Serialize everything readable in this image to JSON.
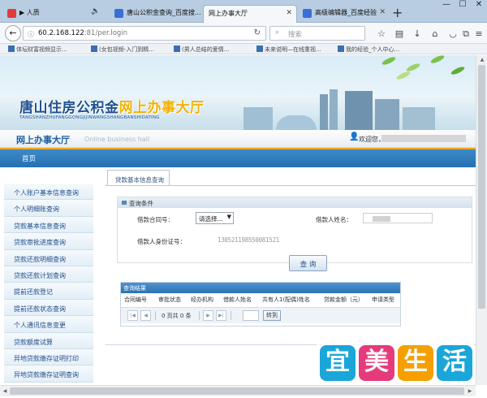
{
  "browser": {
    "tabs": [
      {
        "label": "▶ 人质",
        "active": false
      },
      {
        "label": "唐山公积金查询_百度搜...",
        "active": false
      },
      {
        "label": "网上办事大厅",
        "active": true
      },
      {
        "label": "高级编辑器_百度经验",
        "active": false
      }
    ],
    "new_tab": "+",
    "window_controls": {
      "minimize": "—",
      "maximize": "☐",
      "close": "✕"
    },
    "address": {
      "domain": "60.2.168.122",
      "rest": ":81/per.login"
    },
    "search_placeholder": "搜索",
    "bookmarks": [
      "体坛财富视频显示...",
      "(女包视频-入门到精...",
      "(男人总结的爱情...",
      "未来说明—在线重视...",
      "我的经验_个人中心..."
    ]
  },
  "banner": {
    "title_blue": "唐山住房公积金",
    "title_highlight": "网上办事大厅",
    "pinyin": "TANGSHANZHUFANGGONGJIJINWANGSHANGBANSHIDATING"
  },
  "header": {
    "hall_title": "网上办事大厅",
    "hall_subtitle": "Online business hall",
    "welcome": "欢迎您，"
  },
  "nav": {
    "home": "首页"
  },
  "sidebar": {
    "items": [
      "个人账户基本信息查询",
      "个人明细账查询",
      "贷款基本信息查询",
      "贷款审批进度查询",
      "贷款还款明细查询",
      "贷款还款计划查询",
      "提前还款登记",
      "提前还款状态查询",
      "个人通讯信息变更",
      "贷款额度试算",
      "异地贷款缴存证明打印",
      "异地贷款缴存证明查询"
    ]
  },
  "main": {
    "tab_label": "贷款基本信息查询",
    "conditions_title": "查询条件",
    "contract_label": "借款合同号：",
    "contract_select": "请选择...",
    "borrower_name_label": "借款人姓名：",
    "borrower_id_label": "借款人身份证号：",
    "borrower_id_value": "130521198550081521",
    "query_button": "查 询",
    "results_title": "查询结果",
    "columns": [
      "合同编号",
      "审批状态",
      "经办机构",
      "借款人姓名",
      "共有人1(配偶)姓名",
      "贷款金额（元）",
      "申请类型"
    ],
    "pager": {
      "text": "0 页共 0 条",
      "go": "转到"
    }
  },
  "watermark": {
    "chars": [
      "宜",
      "美",
      "生",
      "活"
    ],
    "colors": [
      "#1aa6d9",
      "#e63b7a",
      "#f5a000",
      "#1aa6d9"
    ]
  }
}
